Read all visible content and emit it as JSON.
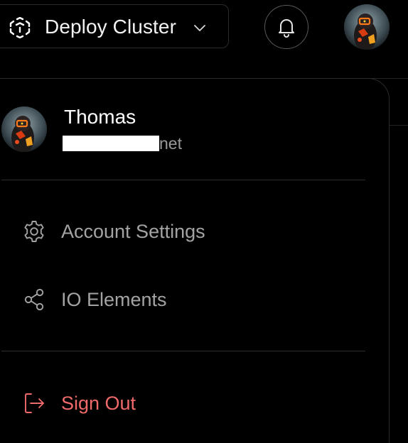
{
  "topbar": {
    "cluster_label": "Deploy Cluster",
    "cluster_icon": "cluster-icon",
    "chevron_icon": "chevron-down-icon",
    "bell_icon": "bell-icon",
    "avatar_icon": "avatar"
  },
  "user": {
    "name": "Thomas",
    "email_visible_suffix": "net"
  },
  "menu": {
    "items": [
      {
        "label": "Account Settings",
        "icon": "gear-icon"
      },
      {
        "label": "IO Elements",
        "icon": "share-icon"
      }
    ],
    "sign_out_label": "Sign Out",
    "sign_out_icon": "sign-out-icon"
  },
  "colors": {
    "background": "#000000",
    "text_primary": "#ffffff",
    "text_muted": "#a3a3a3",
    "danger": "#f06a6a",
    "border": "#2a2a2a"
  }
}
